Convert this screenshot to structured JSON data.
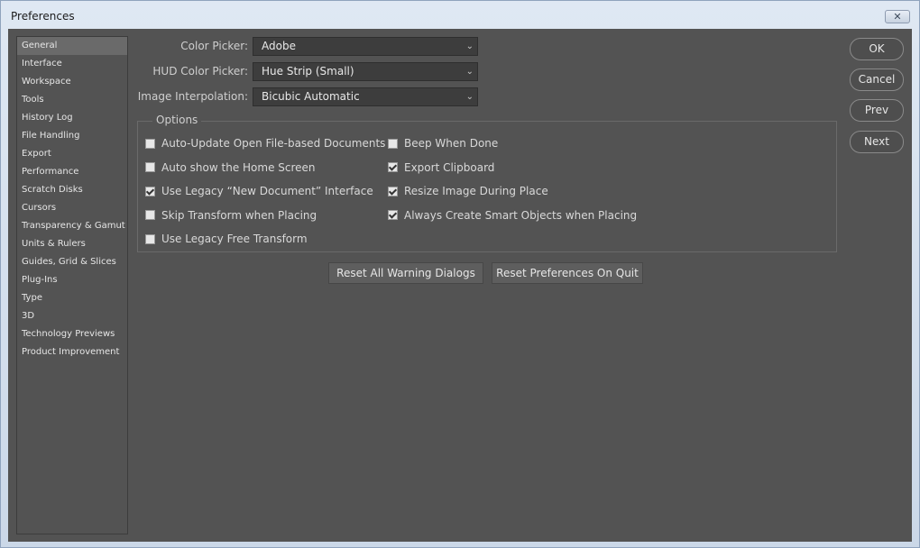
{
  "window": {
    "title": "Preferences",
    "close_glyph": "✕"
  },
  "sidebar": {
    "items": [
      {
        "label": "General",
        "selected": true
      },
      {
        "label": "Interface"
      },
      {
        "label": "Workspace"
      },
      {
        "label": "Tools"
      },
      {
        "label": "History Log"
      },
      {
        "label": "File Handling"
      },
      {
        "label": "Export"
      },
      {
        "label": "Performance"
      },
      {
        "label": "Scratch Disks"
      },
      {
        "label": "Cursors"
      },
      {
        "label": "Transparency & Gamut"
      },
      {
        "label": "Units & Rulers"
      },
      {
        "label": "Guides, Grid & Slices"
      },
      {
        "label": "Plug-Ins"
      },
      {
        "label": "Type"
      },
      {
        "label": "3D"
      },
      {
        "label": "Technology Previews"
      },
      {
        "label": "Product Improvement"
      }
    ]
  },
  "fields": {
    "color_picker": {
      "label": "Color Picker:",
      "value": "Adobe"
    },
    "hud_color_picker": {
      "label": "HUD Color Picker:",
      "value": "Hue Strip (Small)"
    },
    "image_interpolation": {
      "label": "Image Interpolation:",
      "value": "Bicubic Automatic"
    }
  },
  "options": {
    "label": "Options",
    "left": [
      {
        "label": "Auto-Update Open File-based Documents",
        "checked": false
      },
      {
        "label": "Auto show the Home Screen",
        "checked": false
      },
      {
        "label": "Use Legacy “New Document” Interface",
        "checked": true
      },
      {
        "label": "Skip Transform when Placing",
        "checked": false
      },
      {
        "label": "Use Legacy Free Transform",
        "checked": false
      }
    ],
    "right": [
      {
        "label": "Beep When Done",
        "checked": false
      },
      {
        "label": "Export Clipboard",
        "checked": true
      },
      {
        "label": "Resize Image During Place",
        "checked": true
      },
      {
        "label": "Always Create Smart Objects when Placing",
        "checked": true
      }
    ]
  },
  "actions": {
    "reset_warnings": "Reset All Warning Dialogs",
    "reset_prefs": "Reset Preferences On Quit"
  },
  "buttons": {
    "ok": "OK",
    "cancel": "Cancel",
    "prev": "Prev",
    "next": "Next"
  },
  "icons": {
    "chevron": "⌄"
  }
}
